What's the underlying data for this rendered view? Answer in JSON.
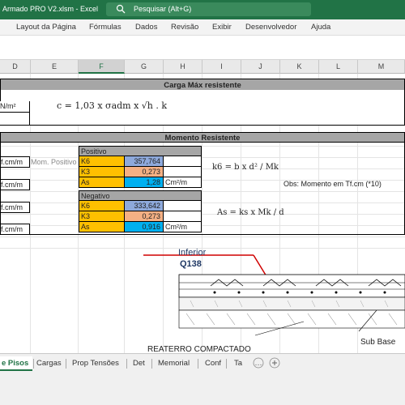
{
  "window": {
    "title": "Armado PRO V2.xlsm  -  Excel"
  },
  "search": {
    "placeholder": "Pesquisar (Alt+G)"
  },
  "ribbon": {
    "tabs": [
      "Layout da Página",
      "Fórmulas",
      "Dados",
      "Revisão",
      "Exibir",
      "Desenvolvedor",
      "Ajuda"
    ]
  },
  "columns": [
    "D",
    "E",
    "F",
    "G",
    "H",
    "I",
    "J",
    "K",
    "L",
    "M"
  ],
  "selected_column": "F",
  "sheet": {
    "carga_header": "Carga Máx resistente",
    "carga_unit": "N/m²",
    "carga_formula": "c = 1,03 x σadm x √h . k",
    "momento_header": "Momento Resistente",
    "left_units": [
      "f.cm/m",
      "f.cm/m",
      "f.cm/m",
      "f.cm/m"
    ],
    "mom_positivo_label": "Mom. Positivo N",
    "positivo": {
      "title": "Positivo",
      "k6_label": "K6",
      "k6_value": "357,764",
      "k3_label": "K3",
      "k3_value": "0,273",
      "as_label": "As",
      "as_value": "1,28",
      "as_unit": "Cm²/m"
    },
    "negativo": {
      "title": "Negativo",
      "k6_label": "K6",
      "k6_value": "333,642",
      "k3_label": "K3",
      "k3_value": "0,273",
      "as_label": "As",
      "as_value": "0,916",
      "as_unit": "Cm²/m"
    },
    "formula_k6": "k6 = b x d² / Mk",
    "formula_as": "As = ks x Mk / d",
    "obs": "Obs: Momento em Tf.cm (*10)",
    "drawing": {
      "label_inferior": "Inferior",
      "label_q138": "Q138",
      "label_reaterro": "REATERRO  COMPACTADO",
      "label_subbase": "Sub  Base"
    }
  },
  "sheet_tabs": [
    "e Pisos",
    "Cargas",
    "Prop Tensões",
    "Det",
    "Memorial",
    "Conf",
    "Ta"
  ],
  "active_tab": "e Pisos",
  "colors": {
    "excel_green": "#217346",
    "orange": "#ffc000",
    "blue": "#8ea9db",
    "salmon": "#f4b084",
    "cyan": "#00b0f0",
    "red_arrow": "#d00000",
    "drawing_blue": "#1f3864"
  }
}
